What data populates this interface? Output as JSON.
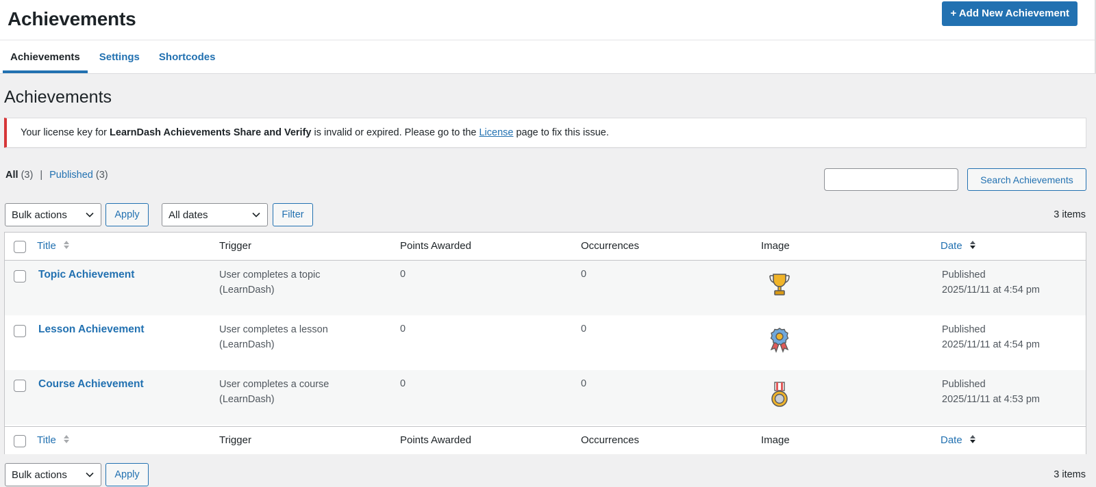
{
  "header": {
    "app_title": "Achievements",
    "add_new_label": "+ Add New Achievement",
    "tabs": [
      {
        "label": "Achievements",
        "active": true
      },
      {
        "label": "Settings",
        "active": false
      },
      {
        "label": "Shortcodes",
        "active": false
      }
    ]
  },
  "page": {
    "heading": "Achievements"
  },
  "notice": {
    "prefix": "Your license key for",
    "plugin_name": "LearnDash Achievements Share and Verify",
    "middle": "is invalid or expired. Please go to the",
    "link_text": "License",
    "suffix": "page to fix this issue.",
    "border_color": "#d63638"
  },
  "views": {
    "all_label": "All",
    "all_count": "(3)",
    "separator": "|",
    "published_label": "Published",
    "published_count": "(3)"
  },
  "search": {
    "placeholder": "",
    "value": "",
    "button_label": "Search Achievements"
  },
  "top_nav": {
    "bulk_actions": "Bulk actions",
    "apply_label": "Apply",
    "dates": "All dates",
    "filter_label": "Filter",
    "items_count": "3 items"
  },
  "bottom_nav": {
    "bulk_actions": "Bulk actions",
    "apply_label": "Apply",
    "items_count": "3 items"
  },
  "table": {
    "columns": {
      "title": "Title",
      "trigger": "Trigger",
      "points": "Points Awarded",
      "occurrences": "Occurrences",
      "image": "Image",
      "date": "Date"
    },
    "rows": [
      {
        "title": "Topic Achievement",
        "trigger_line1": "User completes a topic",
        "trigger_line2": "(LearnDash)",
        "points": "0",
        "occurrences": "0",
        "image_icon": "trophy-icon",
        "status": "Published",
        "date": "2025/11/11 at 4:54 pm"
      },
      {
        "title": "Lesson Achievement",
        "trigger_line1": "User completes a lesson",
        "trigger_line2": "(LearnDash)",
        "points": "0",
        "occurrences": "0",
        "image_icon": "ribbon-badge-icon",
        "status": "Published",
        "date": "2025/11/11 at 4:54 pm"
      },
      {
        "title": "Course Achievement",
        "trigger_line1": "User completes a course",
        "trigger_line2": "(LearnDash)",
        "points": "0",
        "occurrences": "0",
        "image_icon": "medal-icon",
        "status": "Published",
        "date": "2025/11/11 at 4:53 pm"
      }
    ]
  },
  "colors": {
    "accent": "#2271b1",
    "text": "#1d2327",
    "background": "#f0f0f1",
    "row_alt": "#f6f7f7"
  }
}
